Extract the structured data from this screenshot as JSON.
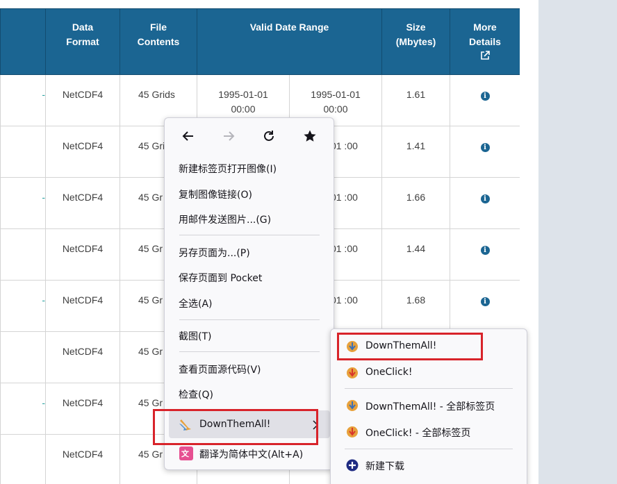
{
  "table": {
    "headers": {
      "data_format": "Data Format",
      "file_contents": "File Contents",
      "valid_date_range": "Valid Date Range",
      "size": "Size (Mbytes)",
      "more_details": "More Details"
    },
    "rows": [
      {
        "marker": "-",
        "format": "NetCDF4",
        "contents": "45 Grids",
        "start": "1995-01-01 00:00",
        "end": "1995-01-01 00:00",
        "size": "1.61"
      },
      {
        "marker": "",
        "format": "NetCDF4",
        "contents": "45 Gri",
        "start": "",
        "end": "-01-01 :00",
        "size": "1.41"
      },
      {
        "marker": "-",
        "format": "NetCDF4",
        "contents": "45 Gr",
        "start": "",
        "end": "-02-01 :00",
        "size": "1.66"
      },
      {
        "marker": "",
        "format": "NetCDF4",
        "contents": "45 Gr",
        "start": "",
        "end": "-02-01 :00",
        "size": "1.44"
      },
      {
        "marker": "-",
        "format": "NetCDF4",
        "contents": "45 Gr",
        "start": "",
        "end": "-03-01 :00",
        "size": "1.68"
      },
      {
        "marker": "",
        "format": "NetCDF4",
        "contents": "45 Gr",
        "start": "",
        "end": "",
        "size": ""
      },
      {
        "marker": "-",
        "format": "NetCDF4",
        "contents": "45 Gr",
        "start": "",
        "end": "",
        "size": ""
      },
      {
        "marker": "",
        "format": "NetCDF4",
        "contents": "45 Gr",
        "start": "",
        "end": "",
        "size": ""
      }
    ],
    "info_glyph": "i"
  },
  "context_menu": {
    "nav_icons": [
      "back-arrow-icon",
      "forward-arrow-icon",
      "reload-icon",
      "bookmark-star-icon"
    ],
    "items": {
      "open_image_new_tab": "新建标签页打开图像(I)",
      "copy_image_link": "复制图像链接(O)",
      "email_image": "用邮件发送图片...(G)",
      "save_page_as": "另存页面为...(P)",
      "save_to_pocket": "保存页面到 Pocket",
      "select_all": "全选(A)",
      "screenshot": "截图(T)",
      "view_source": "查看页面源代码(V)",
      "inspect": "检查(Q)",
      "downthemall": "DownThemAll!",
      "translate": "翻译为简体中文(Alt+A)"
    }
  },
  "submenu": {
    "items": {
      "downthemall": "DownThemAll!",
      "oneclick": "OneClick!",
      "downthemall_all_tabs": "DownThemAll! - 全部标签页",
      "oneclick_all_tabs": "OneClick! - 全部标签页",
      "new_download": "新建下载"
    }
  },
  "colors": {
    "header_bg": "#1b6592",
    "highlight_box": "#d8232a",
    "accent_teal": "#2aa2a0"
  }
}
